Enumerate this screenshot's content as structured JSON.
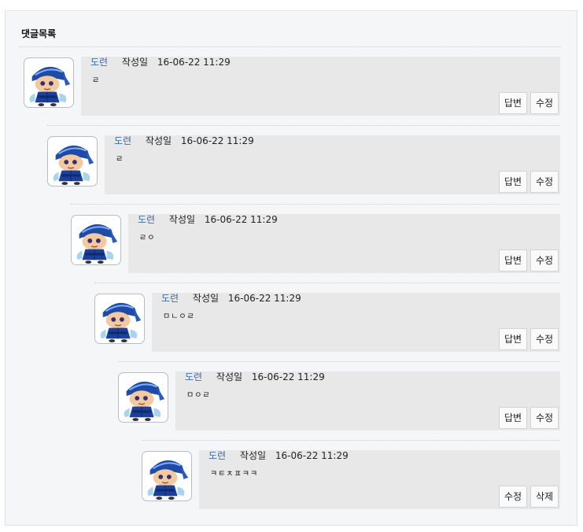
{
  "panel": {
    "title": "댓글목록"
  },
  "comments": [
    {
      "author": "도련",
      "date_label": "작성일",
      "date": "16-06-22 11:29",
      "text": "ㄹ",
      "buttons": [
        "답변",
        "수정"
      ]
    },
    {
      "author": "도련",
      "date_label": "작성일",
      "date": "16-06-22 11:29",
      "text": "ㄹ",
      "buttons": [
        "답변",
        "수정"
      ]
    },
    {
      "author": "도련",
      "date_label": "작성일",
      "date": "16-06-22 11:29",
      "text": "ㄹㅇ",
      "buttons": [
        "답변",
        "수정"
      ]
    },
    {
      "author": "도련",
      "date_label": "작성일",
      "date": "16-06-22 11:29",
      "text": "ㅁㄴㅇㄹ",
      "buttons": [
        "답변",
        "수정"
      ]
    },
    {
      "author": "도련",
      "date_label": "작성일",
      "date": "16-06-22 11:29",
      "text": "ㅁㅇㄹ",
      "buttons": [
        "답변",
        "수정"
      ]
    },
    {
      "author": "도련",
      "date_label": "작성일",
      "date": "16-06-22 11:29",
      "text": "ㅋㅌㅊㅍㅋㅋ",
      "buttons": [
        "수정",
        "삭제"
      ]
    }
  ]
}
